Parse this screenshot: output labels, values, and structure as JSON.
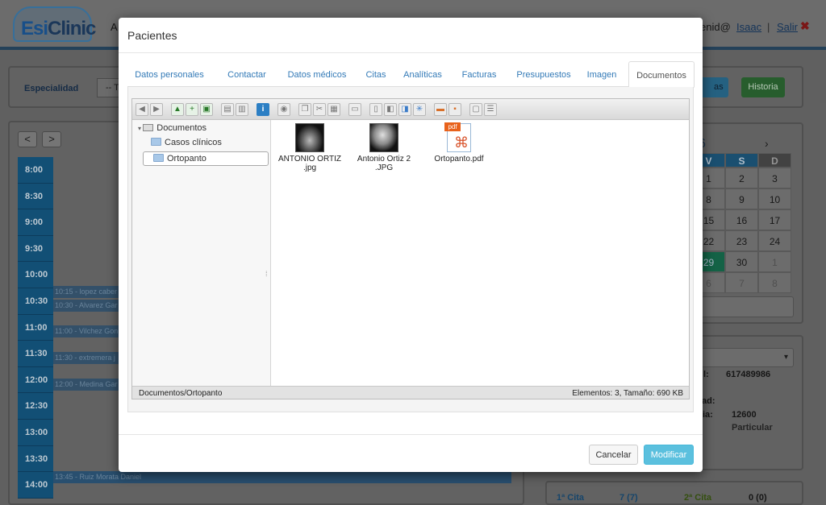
{
  "app": {
    "menu_fragment": "A",
    "user_email_fragment": "enid@",
    "user_name": "Isaac",
    "separator": "|",
    "logout": "Salir",
    "logout_icon": "✖",
    "logo_prefix": "Esi",
    "logo_suffix": "Clinic"
  },
  "filters": {
    "especialidad_label": "Especialidad",
    "especialidad_value": "-- Tod",
    "btn_partial": "as",
    "historia": "Historia"
  },
  "calendar": {
    "prev": "<",
    "next": ">",
    "times": [
      "8:00",
      "8:30",
      "9:00",
      "9:30",
      "10:00",
      "10:30",
      "11:00",
      "11:30",
      "12:00",
      "12:30",
      "13:00",
      "13:30",
      "14:00"
    ],
    "appointments": [
      {
        "text": "10:15 - lopez caber"
      },
      {
        "text": "10:30 - Alvarez Gar"
      },
      {
        "text": "11:00 - Vilchez Gon"
      },
      {
        "text": "11:30 - extremera j"
      },
      {
        "text": "12:00 - Medina Gar"
      },
      {
        "text": "13:45 - Ruiz Morata Daniel"
      }
    ]
  },
  "mini_calendar": {
    "month_fragment": "6",
    "next": "›",
    "headers": [
      "V",
      "S",
      "D"
    ],
    "rows": [
      [
        "1",
        "2",
        "3"
      ],
      [
        "8",
        "9",
        "10"
      ],
      [
        "15",
        "16",
        "17"
      ],
      [
        "22",
        "23",
        "24"
      ],
      [
        "29",
        "30",
        "1"
      ],
      [
        "6",
        "7",
        "8"
      ]
    ],
    "today": "29"
  },
  "patient_info": {
    "phone_label_fragment": "l:",
    "phone": "617489986",
    "city_label_fragment": "ad:",
    "zone_label_fragment": "oria:",
    "postal": "12600",
    "type": "Particular",
    "first_visit_label": "1ª Cita",
    "first_visit_value": "7 (7)",
    "second_visit_label": "2ª Cita",
    "second_visit_value": "0 (0)"
  },
  "modal": {
    "title": "Pacientes",
    "tabs": [
      "Datos personales",
      "Contactar",
      "Datos médicos",
      "Citas",
      "Analíticas",
      "Facturas",
      "Presupuestos",
      "Imagen",
      "Documentos"
    ],
    "active_tab": "Documentos",
    "tree": {
      "root": "Documentos",
      "children": [
        "Casos clínicos",
        "Ortopanto"
      ],
      "selected": "Ortopanto"
    },
    "files": [
      {
        "name_line1": "ANTONIO ORTIZ",
        "name_line2": ".jpg",
        "icon": "xray-thumbnail-icon"
      },
      {
        "name_line1": "Antonio Ortiz 2",
        "name_line2": ".JPG",
        "icon": "xray-thumbnail-icon"
      },
      {
        "name_line1": "Ortopanto.pdf",
        "name_line2": "",
        "icon": "pdf-file-icon",
        "badge": "pdf"
      }
    ],
    "status_path": "Documentos/Ortopanto",
    "status_info": "Elementos: 3, Tamaño: 690 KB",
    "cancel": "Cancelar",
    "ok": "Modificar"
  },
  "colors": {
    "primary_button": "#5bc0de",
    "historia_button": "#2d6a34",
    "today": "#177050",
    "time_column": "#155a86"
  }
}
